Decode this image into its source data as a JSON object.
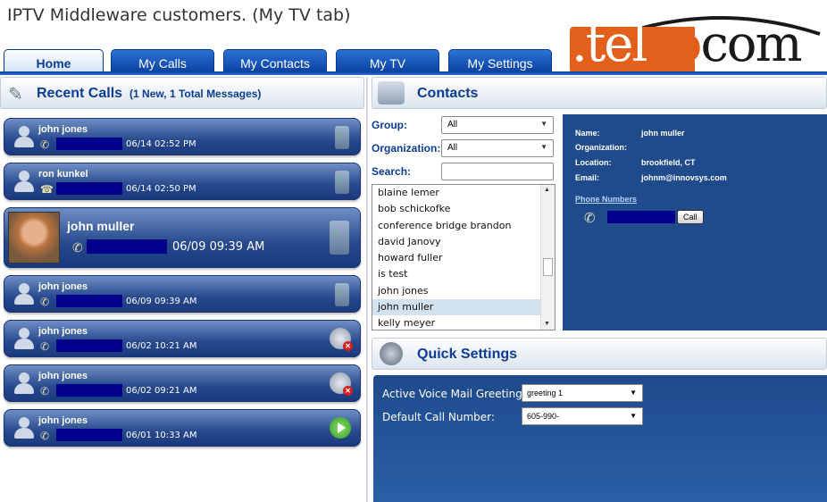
{
  "caption": "IPTV Middleware customers. (My TV tab)",
  "logo": {
    "prefix": ".tel",
    "middle": "co",
    "suffix": "com"
  },
  "tabs": [
    "Home",
    "My Calls",
    "My Contacts",
    "My TV",
    "My Settings"
  ],
  "recent_calls": {
    "title": "Recent Calls",
    "subtitle": "(1 New, 1 Total Messages)",
    "items": [
      {
        "name": "john jones",
        "time": "06/14 02:52 PM",
        "status": "phone-green-arrow"
      },
      {
        "name": "ron  kunkel",
        "time": "06/14 02:50 PM",
        "status": "phone-green-arrow"
      },
      {
        "name": "john muller",
        "time": "06/09 09:39 AM",
        "status": "phone-green-arrow",
        "has_photo": true
      },
      {
        "name": "john jones",
        "time": "06/09 09:39 AM",
        "status": "phone-green-arrow"
      },
      {
        "name": "john jones",
        "time": "06/02 10:21 AM",
        "status": "voicemail-deleted"
      },
      {
        "name": "john jones",
        "time": "06/02 09:21 AM",
        "status": "voicemail-deleted"
      },
      {
        "name": "john jones",
        "time": "06/01 10:33 AM",
        "status": "voicemail-play"
      }
    ]
  },
  "contacts": {
    "title": "Contacts",
    "group_label": "Group:",
    "group_value": "All",
    "org_label": "Organization:",
    "org_value": "All",
    "search_label": "Search:",
    "search_value": "",
    "list": [
      "blaine lemer",
      "bob schickofke",
      "conference bridge brandon",
      "david  Janovy",
      "howard  fuller",
      "is test",
      "john jones",
      "john muller",
      "kelly meyer"
    ],
    "selected": "john muller"
  },
  "contact_detail": {
    "name_label": "Name:",
    "name": "john muller",
    "org_label": "Organization:",
    "org": "",
    "location_label": "Location:",
    "location": "brookfield, CT",
    "email_label": "Email:",
    "email": "johnm@innovsys.com",
    "phone_numbers_label": "Phone Numbers",
    "call_button": "Call"
  },
  "quick_settings": {
    "title": "Quick Settings",
    "greeting_label": "Active Voice Mail Greeting:",
    "greeting_value": "greeting 1",
    "default_number_label": "Default Call Number:",
    "default_number_value": "605-990-"
  },
  "colors": {
    "brand_orange": "#e2601c",
    "tab_blue": "#0a3ea0",
    "panel_blue": "#1f4a8c"
  }
}
